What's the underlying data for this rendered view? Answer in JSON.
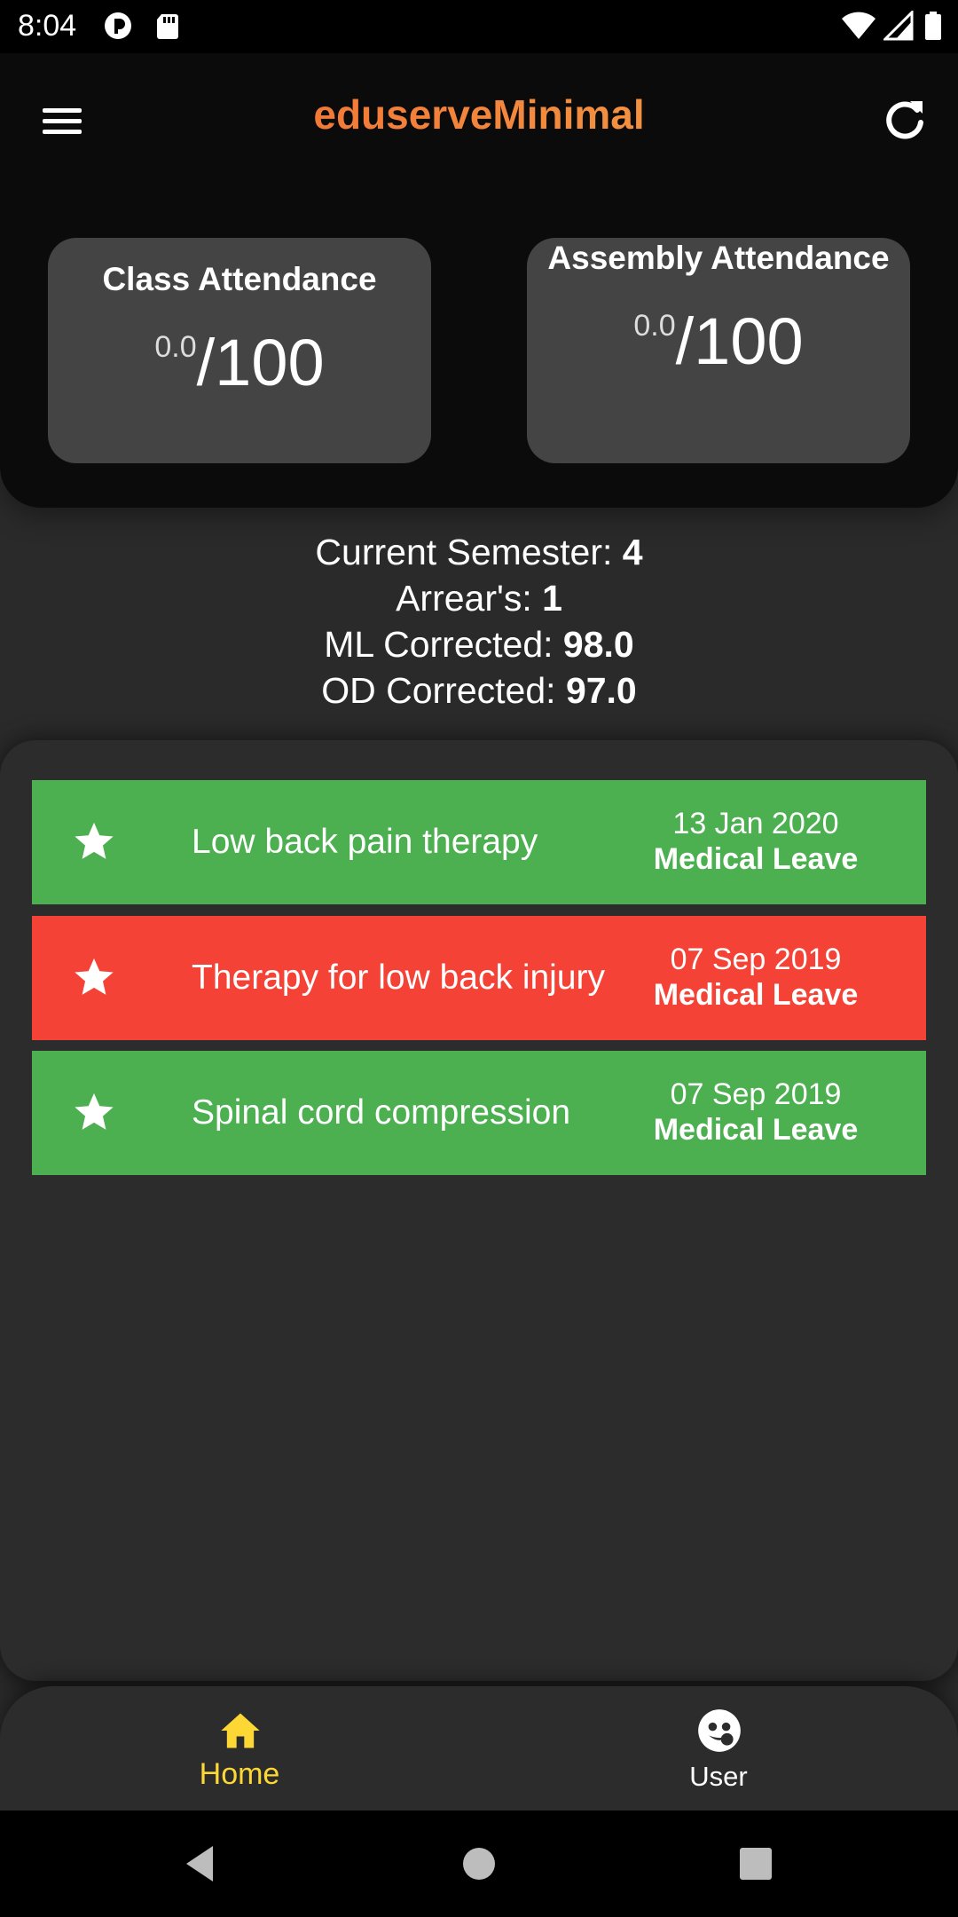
{
  "status_bar": {
    "time": "8:04",
    "left_icons": [
      "pocket-casts-icon",
      "sd-card-icon"
    ],
    "right_icons": [
      "wifi-icon",
      "signal-icon",
      "battery-icon"
    ]
  },
  "app_bar": {
    "title": "eduserveMinimal",
    "menu_icon": "menu-icon",
    "refresh_icon": "refresh-icon",
    "title_gradient": [
      "#f0622e",
      "#f4a84a"
    ]
  },
  "attendance": {
    "class": {
      "title": "Class Attendance",
      "value": "0.0",
      "max": "/100"
    },
    "assembly": {
      "title": "Assembly Attendance",
      "value": "0.0",
      "max": "/100"
    }
  },
  "stats": [
    {
      "label": "Current Semester: ",
      "value": "4"
    },
    {
      "label": "Arrear's: ",
      "value": "1"
    },
    {
      "label": "ML Corrected: ",
      "value": "98.0"
    },
    {
      "label": "OD Corrected: ",
      "value": "97.0"
    }
  ],
  "leaves": [
    {
      "title": "Low back pain therapy",
      "date": "13 Jan 2020",
      "type": "Medical Leave",
      "color": "#4caf50",
      "icon": "star-icon"
    },
    {
      "title": "Therapy for low back injury",
      "date": "07 Sep 2019",
      "type": "Medical Leave",
      "color": "#f44336",
      "icon": "star-icon"
    },
    {
      "title": "Spinal cord compression",
      "date": "07 Sep 2019",
      "type": "Medical Leave",
      "color": "#4caf50",
      "icon": "star-icon"
    }
  ],
  "bottom_nav": {
    "home_label": "Home",
    "user_label": "User",
    "active_color": "#fdd835",
    "home_icon": "home-icon",
    "user_icon": "user-face-icon"
  },
  "system_nav": [
    "back-icon",
    "home-circle-icon",
    "recents-icon"
  ]
}
